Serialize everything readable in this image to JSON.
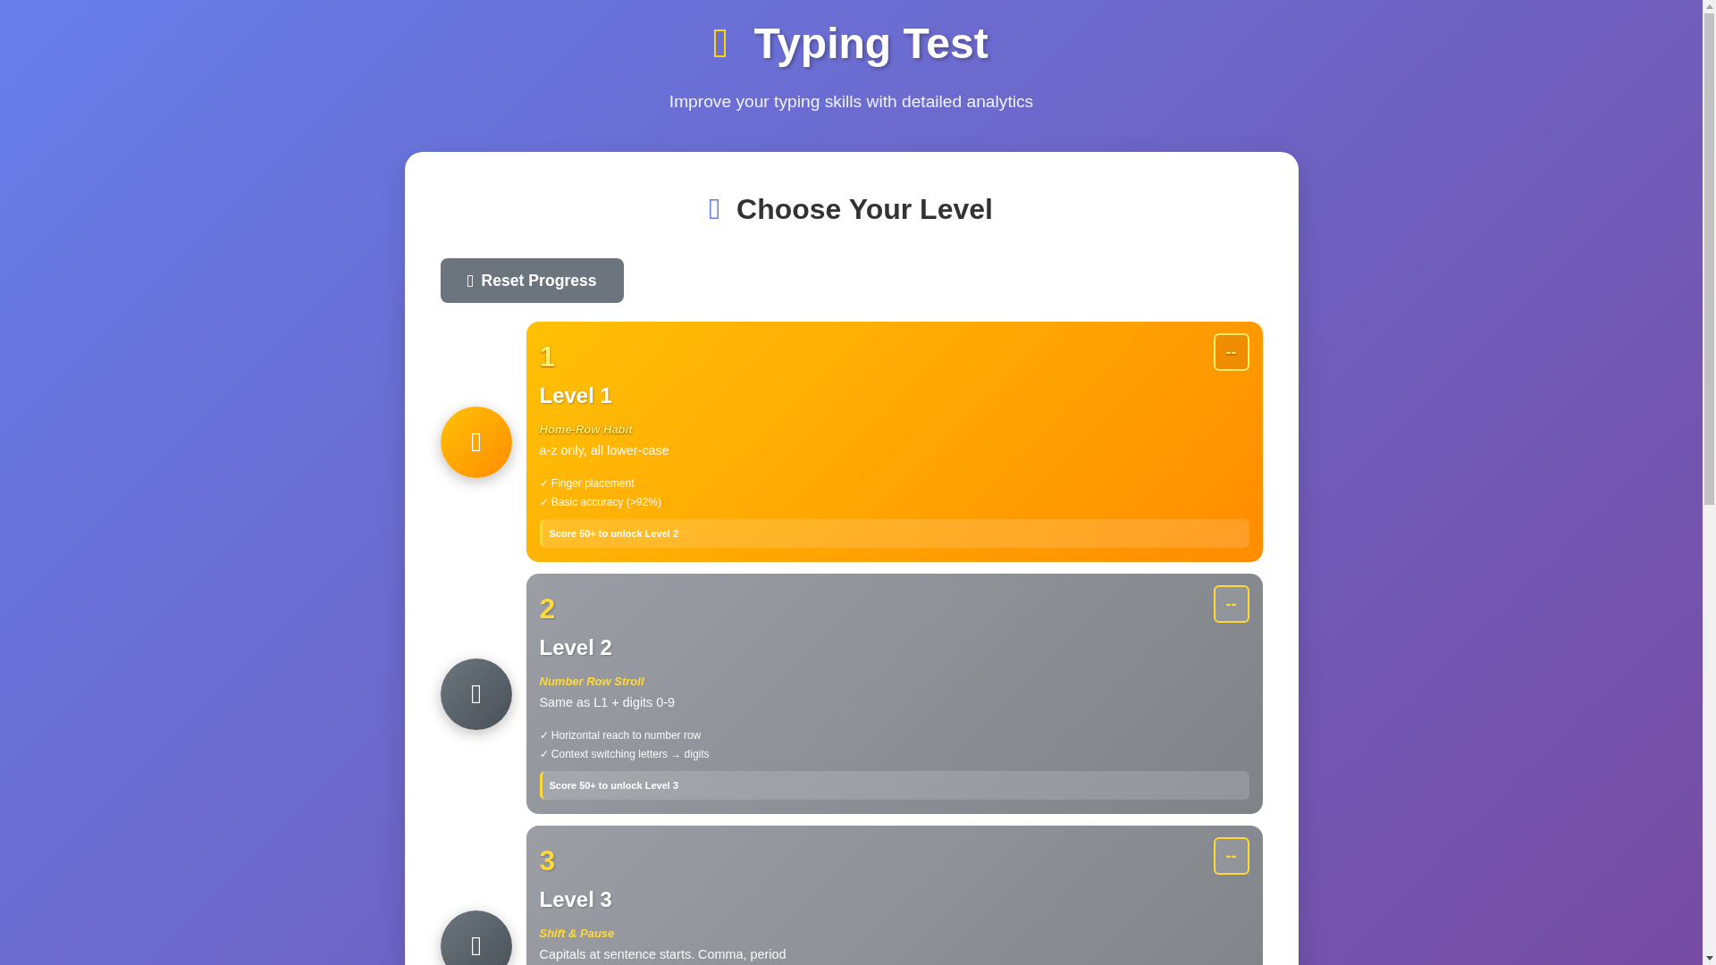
{
  "header": {
    "title": "Typing Test",
    "subtitle": "Improve your typing skills with detailed analytics"
  },
  "panel": {
    "heading": "Choose Your Level",
    "reset_button": "Reset Progress",
    "levels": [
      {
        "number": "1",
        "title": "Level 1",
        "name": "Home-Row Habit",
        "description": "a-z only, all lower-case",
        "features": [
          "✓ Finger placement",
          "✓ Basic accuracy (>92%)"
        ],
        "unlock_hint": "Score 50+ to unlock Level 2",
        "score": "--",
        "locked": false
      },
      {
        "number": "2",
        "title": "Level 2",
        "name": "Number Row Stroll",
        "description": "Same as L1 + digits 0-9",
        "features": [
          "✓ Horizontal reach to number row",
          "✓ Context switching letters → digits"
        ],
        "unlock_hint": "Score 50+ to unlock Level 3",
        "score": "--",
        "locked": true
      },
      {
        "number": "3",
        "title": "Level 3",
        "name": "Shift & Pause",
        "description": "Capitals at sentence starts. Comma, period",
        "score": "--",
        "locked": true
      }
    ]
  }
}
